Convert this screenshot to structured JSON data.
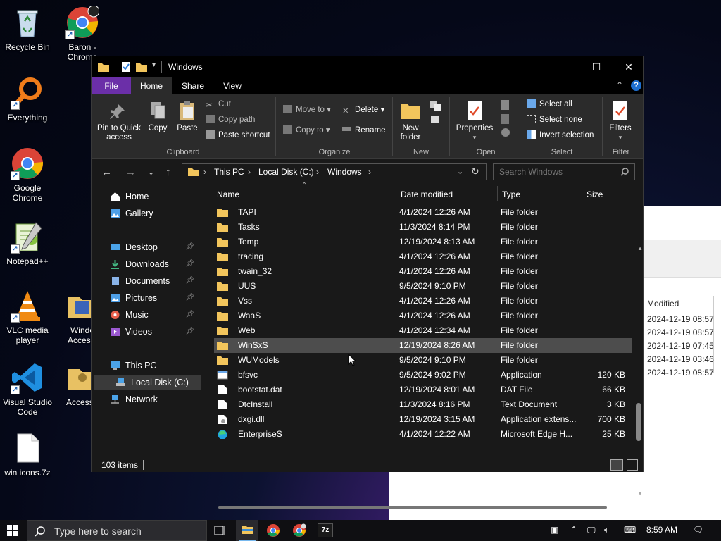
{
  "desktop": {
    "icons": [
      {
        "label": "Recycle Bin",
        "icon": "recycle-bin-icon"
      },
      {
        "label": "Baron - Chrome",
        "icon": "chrome-icon"
      },
      {
        "label": "Everything",
        "icon": "everything-icon"
      },
      {
        "label": "Google Chrome",
        "icon": "chrome-icon"
      },
      {
        "label": "Notepad++",
        "icon": "notepadpp-icon"
      },
      {
        "label": "VLC media player",
        "icon": "vlc-icon"
      },
      {
        "label": "Windo Accesso",
        "icon": "folder-icon"
      },
      {
        "label": "Visual Studio Code",
        "icon": "vscode-icon"
      },
      {
        "label": "Accessib",
        "icon": "folder-icon"
      },
      {
        "label": "win icons.7z",
        "icon": "file-icon"
      }
    ]
  },
  "background_window": {
    "column_header": "Modified",
    "values": [
      "2024-12-19 08:57",
      "2024-12-19 08:57",
      "2024-12-19 07:45",
      "2024-12-19 03:46",
      "2024-12-19 08:57"
    ]
  },
  "explorer": {
    "title": "Windows",
    "tabs": {
      "file": "File",
      "home": "Home",
      "share": "Share",
      "view": "View"
    },
    "ribbon": {
      "clipboard": {
        "label": "Clipboard",
        "pin": "Pin to Quick access",
        "copy": "Copy",
        "paste": "Paste",
        "cut": "Cut",
        "copy_path": "Copy path",
        "paste_shortcut": "Paste shortcut"
      },
      "organize": {
        "label": "Organize",
        "move_to": "Move to",
        "copy_to": "Copy to",
        "delete": "Delete",
        "rename": "Rename"
      },
      "new": {
        "label": "New",
        "new_folder": "New folder"
      },
      "open": {
        "label": "Open",
        "properties": "Properties"
      },
      "select": {
        "label": "Select",
        "select_all": "Select all",
        "select_none": "Select none",
        "invert": "Invert selection"
      },
      "filter": {
        "label": "Filter",
        "filters": "Filters"
      }
    },
    "address": {
      "crumbs": [
        "This PC",
        "Local Disk (C:)",
        "Windows"
      ]
    },
    "search": {
      "placeholder": "Search Windows"
    },
    "nav": {
      "home": "Home",
      "gallery": "Gallery",
      "desktop": "Desktop",
      "downloads": "Downloads",
      "documents": "Documents",
      "pictures": "Pictures",
      "music": "Music",
      "videos": "Videos",
      "this_pc": "This PC",
      "local_disk": "Local Disk (C:)",
      "network": "Network"
    },
    "columns": {
      "name": "Name",
      "date": "Date modified",
      "type": "Type",
      "size": "Size"
    },
    "rows": [
      {
        "name": "TAPI",
        "date": "4/1/2024 12:26 AM",
        "type": "File folder",
        "size": "",
        "kind": "folder"
      },
      {
        "name": "Tasks",
        "date": "11/3/2024 8:14 PM",
        "type": "File folder",
        "size": "",
        "kind": "folder"
      },
      {
        "name": "Temp",
        "date": "12/19/2024 8:13 AM",
        "type": "File folder",
        "size": "",
        "kind": "folder"
      },
      {
        "name": "tracing",
        "date": "4/1/2024 12:26 AM",
        "type": "File folder",
        "size": "",
        "kind": "folder"
      },
      {
        "name": "twain_32",
        "date": "4/1/2024 12:26 AM",
        "type": "File folder",
        "size": "",
        "kind": "folder"
      },
      {
        "name": "UUS",
        "date": "9/5/2024 9:10 PM",
        "type": "File folder",
        "size": "",
        "kind": "folder"
      },
      {
        "name": "Vss",
        "date": "4/1/2024 12:26 AM",
        "type": "File folder",
        "size": "",
        "kind": "folder"
      },
      {
        "name": "WaaS",
        "date": "4/1/2024 12:26 AM",
        "type": "File folder",
        "size": "",
        "kind": "folder"
      },
      {
        "name": "Web",
        "date": "4/1/2024 12:34 AM",
        "type": "File folder",
        "size": "",
        "kind": "folder"
      },
      {
        "name": "WinSxS",
        "date": "12/19/2024 8:26 AM",
        "type": "File folder",
        "size": "",
        "kind": "folder",
        "selected": true
      },
      {
        "name": "WUModels",
        "date": "9/5/2024 9:10 PM",
        "type": "File folder",
        "size": "",
        "kind": "folder"
      },
      {
        "name": "bfsvc",
        "date": "9/5/2024 9:02 PM",
        "type": "Application",
        "size": "120 KB",
        "kind": "app"
      },
      {
        "name": "bootstat.dat",
        "date": "12/19/2024 8:01 AM",
        "type": "DAT File",
        "size": "66 KB",
        "kind": "file"
      },
      {
        "name": "DtcInstall",
        "date": "11/3/2024 8:16 PM",
        "type": "Text Document",
        "size": "3 KB",
        "kind": "file"
      },
      {
        "name": "dxgi.dll",
        "date": "12/19/2024 3:15 AM",
        "type": "Application extens...",
        "size": "700 KB",
        "kind": "dll"
      },
      {
        "name": "EnterpriseS",
        "date": "4/1/2024 12:22 AM",
        "type": "Microsoft Edge H...",
        "size": "25 KB",
        "kind": "edge"
      }
    ],
    "status": {
      "count": "103 items"
    }
  },
  "taskbar": {
    "search_placeholder": "Type here to search",
    "time": "8:59 AM"
  }
}
